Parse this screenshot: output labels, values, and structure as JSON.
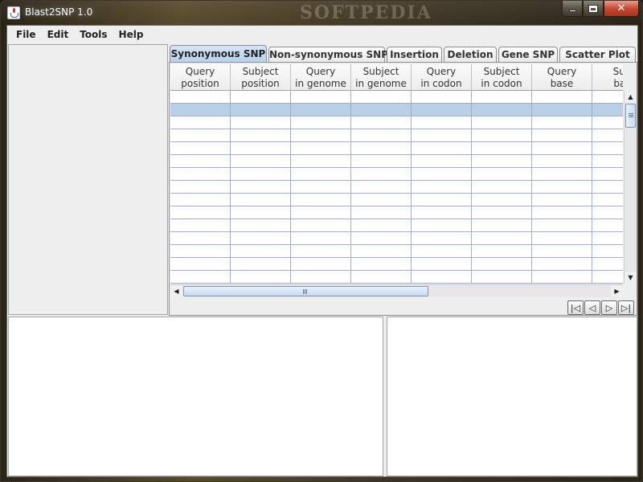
{
  "window": {
    "title": "Blast2SNP 1.0",
    "watermark": "SOFTPEDIA",
    "close_glyph": "✕"
  },
  "menu": [
    "File",
    "Edit",
    "Tools",
    "Help"
  ],
  "tabs": [
    {
      "label": "Synonymous SNP",
      "active": true
    },
    {
      "label": "Non-synonymous SNP",
      "active": false
    },
    {
      "label": "Insertion",
      "active": false
    },
    {
      "label": "Deletion",
      "active": false
    },
    {
      "label": "Gene SNP",
      "active": false
    },
    {
      "label": "Scatter Plot",
      "active": false
    }
  ],
  "table": {
    "columns": [
      "Query\nposition",
      "Subject\nposition",
      "Query\nin genome",
      "Subject\nin genome",
      "Query\nin codon",
      "Subject\nin codon",
      "Query\nbase",
      "Sub\nbas"
    ],
    "selected_row": 1
  },
  "scrollbar_glyphs": {
    "up": "▲",
    "down": "▼",
    "left": "◀",
    "right": "▶"
  },
  "nav_buttons": [
    {
      "name": "first-page-button",
      "glyph": "|◁"
    },
    {
      "name": "previous-page-button",
      "glyph": "◁"
    },
    {
      "name": "next-page-button",
      "glyph": "▷"
    },
    {
      "name": "last-page-button",
      "glyph": "▷|"
    }
  ],
  "colors": {
    "selected_row": "#b8cfe5",
    "active_tab": "#c7dcf2",
    "close_button": "#c64a33"
  }
}
